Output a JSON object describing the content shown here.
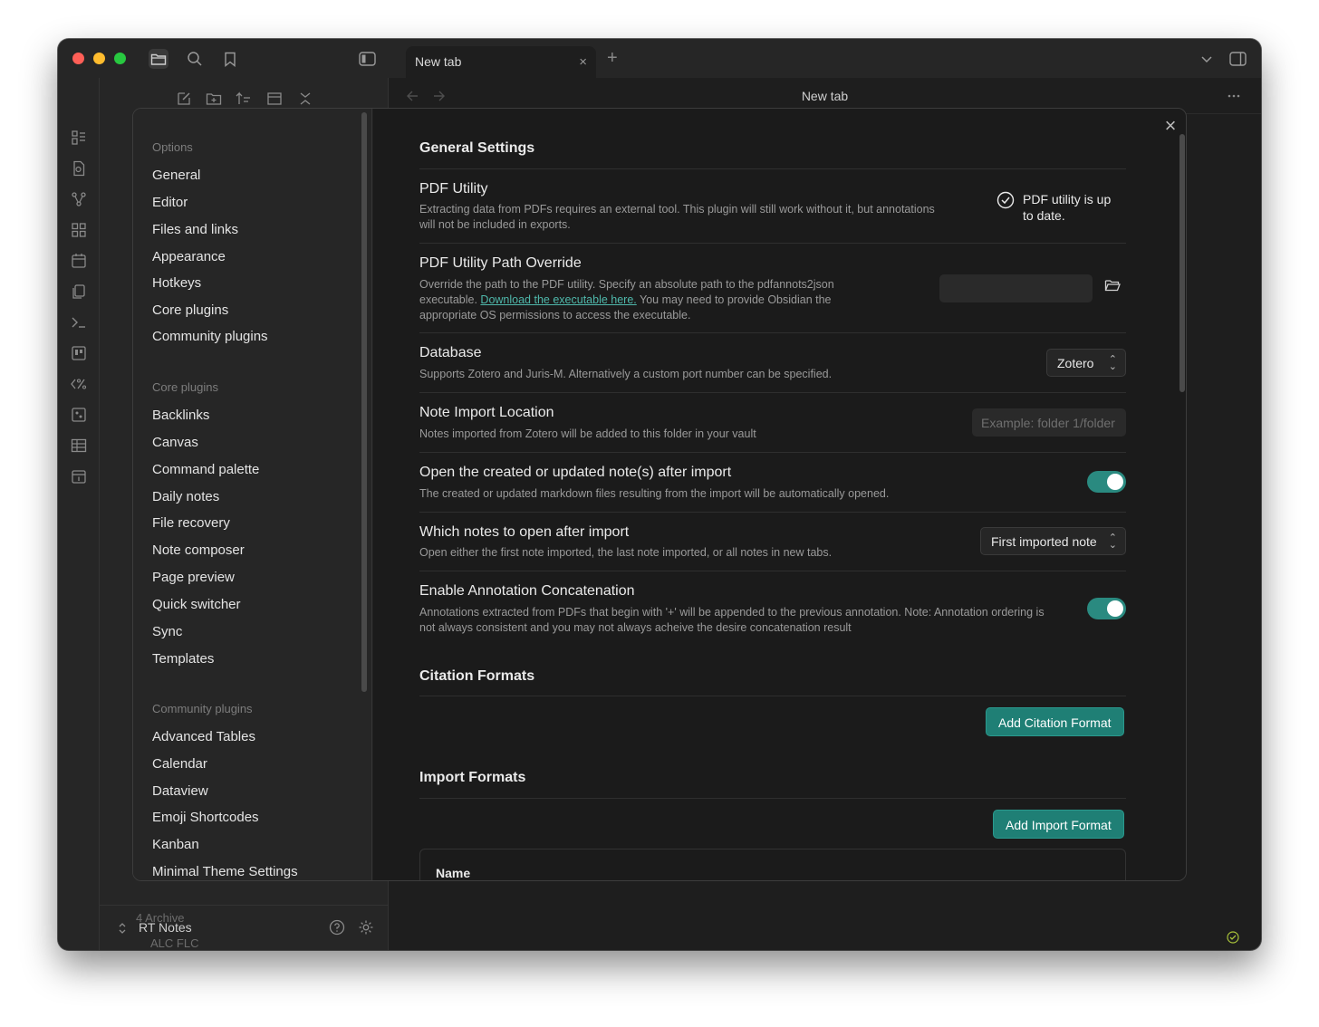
{
  "window": {
    "tab_title": "New tab",
    "tab_close_glyph": "×",
    "tab_plus_glyph": "+",
    "main_title": "New tab",
    "vault_name": "RT Notes"
  },
  "sidebar_tree_partial": [
    "4 Archive",
    "ALC FLC"
  ],
  "ribbon_icons": [
    "dashboard-icon",
    "search-file-icon",
    "graph-icon",
    "grid-icon",
    "calendar-icon",
    "copy-icon",
    "terminal-icon",
    "kanban-icon",
    "percent-code-icon",
    "image-icon",
    "table-icon",
    "daily-calendar-icon"
  ],
  "settings_nav": {
    "groups": [
      {
        "title": "Options",
        "items": [
          "General",
          "Editor",
          "Files and links",
          "Appearance",
          "Hotkeys",
          "Core plugins",
          "Community plugins"
        ]
      },
      {
        "title": "Core plugins",
        "items": [
          "Backlinks",
          "Canvas",
          "Command palette",
          "Daily notes",
          "File recovery",
          "Note composer",
          "Page preview",
          "Quick switcher",
          "Sync",
          "Templates"
        ]
      },
      {
        "title": "Community plugins",
        "items": [
          "Advanced Tables",
          "Calendar",
          "Dataview",
          "Emoji Shortcodes",
          "Kanban",
          "Minimal Theme Settings"
        ]
      }
    ]
  },
  "settings": {
    "close_glyph": "×",
    "general_heading": "General Settings",
    "pdf_utility": {
      "name": "PDF Utility",
      "desc": "Extracting data from PDFs requires an external tool. This plugin will still work without it, but annotations will not be included in exports.",
      "status_line1": "PDF utility is up",
      "status_line2": "to date."
    },
    "pdf_path": {
      "name": "PDF Utility Path Override",
      "desc_before": "Override the path to the PDF utility. Specify an absolute path to the pdfannots2json executable.",
      "link": "Download the executable here.",
      "desc_after": "You may need to provide Obsidian the appropriate OS permissions to access the executable.",
      "value": ""
    },
    "database": {
      "name": "Database",
      "desc": "Supports Zotero and Juris-M. Alternatively a custom port number can be specified.",
      "selected": "Zotero"
    },
    "note_location": {
      "name": "Note Import Location",
      "desc": "Notes imported from Zotero will be added to this folder in your vault",
      "placeholder": "Example: folder 1/folder"
    },
    "open_after_import": {
      "name": "Open the created or updated note(s) after import",
      "desc": "The created or updated markdown files resulting from the import will be automatically opened.",
      "enabled": true
    },
    "which_notes": {
      "name": "Which notes to open after import",
      "desc": "Open either the first note imported, the last note imported, or all notes in new tabs.",
      "selected": "First imported note"
    },
    "concatenation": {
      "name": "Enable Annotation Concatenation",
      "desc": "Annotations extracted from PDFs that begin with '+' will be appended to the previous annotation. Note: Annotation ordering is not always consistent and you may not always acheive the desire concatenation result",
      "enabled": true
    },
    "citation_heading": "Citation Formats",
    "add_citation_label": "Add Citation Format",
    "import_heading": "Import Formats",
    "add_import_label": "Add Import Format",
    "table_header_name": "Name"
  },
  "colors": {
    "accent": "#1f7f75",
    "toggle_on": "#2a8a80",
    "link": "#4fb8ab"
  }
}
